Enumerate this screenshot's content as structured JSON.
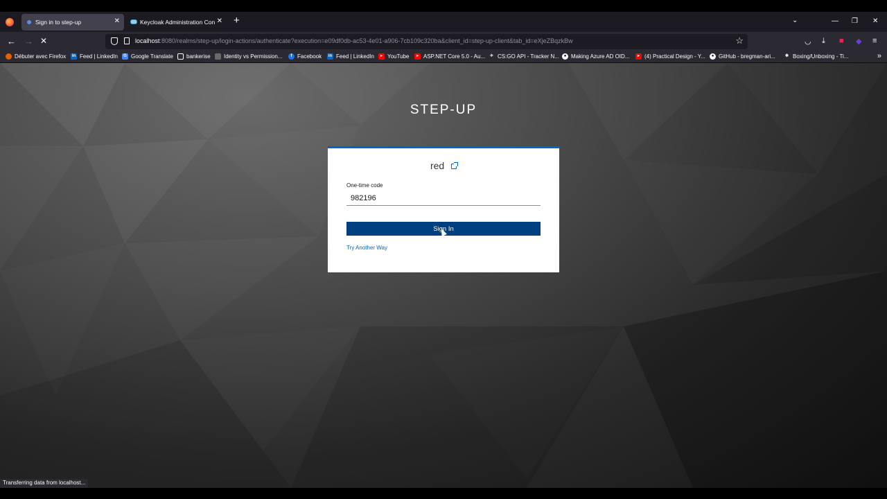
{
  "browser": {
    "tabs": [
      {
        "label": "Sign in to step-up",
        "active": true
      },
      {
        "label": "Keycloak Administration Console",
        "active": false
      }
    ],
    "url": {
      "host": "localhost",
      "rest": ":8080/realms/step-up/login-actions/authenticate?execution=e09df0db-ac53-4e01-a906-7cb109c320ba&client_id=step-up-client&tab_id=eXjeZBqzkBw"
    },
    "bookmarks": [
      {
        "label": "Débuter avec Firefox",
        "icon": "firefox-icon",
        "color": "#e66000"
      },
      {
        "label": "Feed | LinkedIn",
        "icon": "linkedin-icon",
        "color": "#0a66c2"
      },
      {
        "label": "Google Translate",
        "icon": "translate-icon",
        "color": "#4285f4"
      },
      {
        "label": "bankerise",
        "icon": "folder-icon",
        "color": "#2b2a33"
      },
      {
        "label": "Identity vs Permission...",
        "icon": "page-icon",
        "color": "#6b6b6b"
      },
      {
        "label": "Facebook",
        "icon": "facebook-icon",
        "color": "#1877f2"
      },
      {
        "label": "Feed | LinkedIn",
        "icon": "linkedin-icon",
        "color": "#0a66c2"
      },
      {
        "label": "YouTube",
        "icon": "youtube-icon",
        "color": "#ff0000"
      },
      {
        "label": "ASP.NET Core 5.0 - Au...",
        "icon": "youtube-icon",
        "color": "#ff0000"
      },
      {
        "label": "CS:GO API - Tracker N...",
        "icon": "tracker-icon",
        "color": "#2b2a33"
      },
      {
        "label": "Making Azure AD OID...",
        "icon": "medium-icon",
        "color": "#000000"
      },
      {
        "label": "(4) Practical Design - Y...",
        "icon": "youtube-icon",
        "color": "#ff0000"
      },
      {
        "label": "GitHub - bregman-ari...",
        "icon": "github-icon",
        "color": "#ffffff"
      },
      {
        "label": "Boxing/Unboxing - Ti...",
        "icon": "gear-icon",
        "color": "#2b2a33"
      }
    ],
    "status_text": "Transferring data from localhost..."
  },
  "login": {
    "realm_title": "STEP-UP",
    "username": "red",
    "otp_label": "One-time code",
    "otp_value": "982196",
    "sign_in_label": "Sign In",
    "try_another_label": "Try Another Way"
  },
  "colors": {
    "primary": "#0066cc",
    "button": "#004080"
  }
}
